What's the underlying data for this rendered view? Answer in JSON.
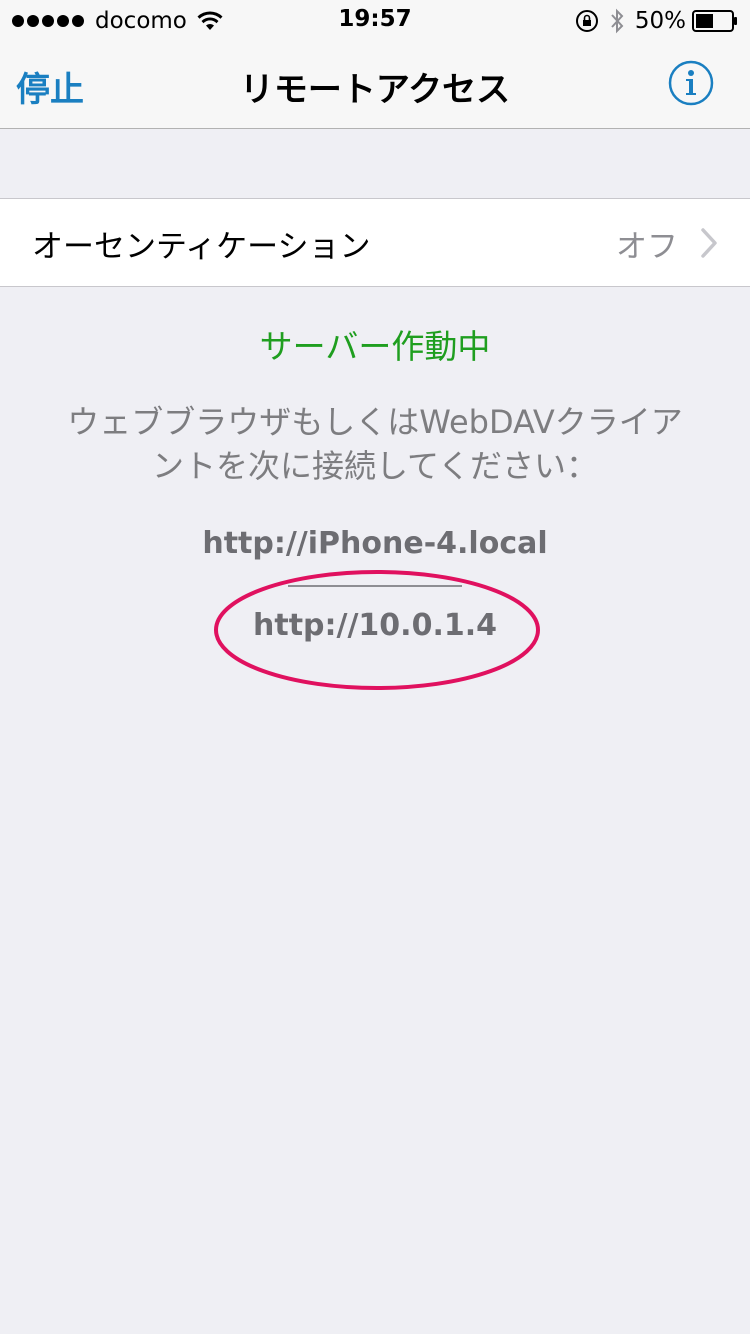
{
  "status_bar": {
    "carrier": "docomo",
    "time": "19:57",
    "battery_percent": "50%",
    "battery_level": 0.5
  },
  "nav": {
    "left_button": "停止",
    "title": "リモートアクセス",
    "info_icon": "info-circle-icon",
    "accent_color": "#1a7fc1"
  },
  "settings": {
    "auth_label": "オーセンティケーション",
    "auth_value": "オフ"
  },
  "content": {
    "server_status": "サーバー作動中",
    "server_status_color": "#1f9e1f",
    "instruction": "ウェブブラウザもしくはWebDAVクライアントを次に接続してください：",
    "url_hostname": "http://iPhone-4.local",
    "url_ip": "http://10.0.1.4",
    "annotation_color": "#e0115f"
  }
}
